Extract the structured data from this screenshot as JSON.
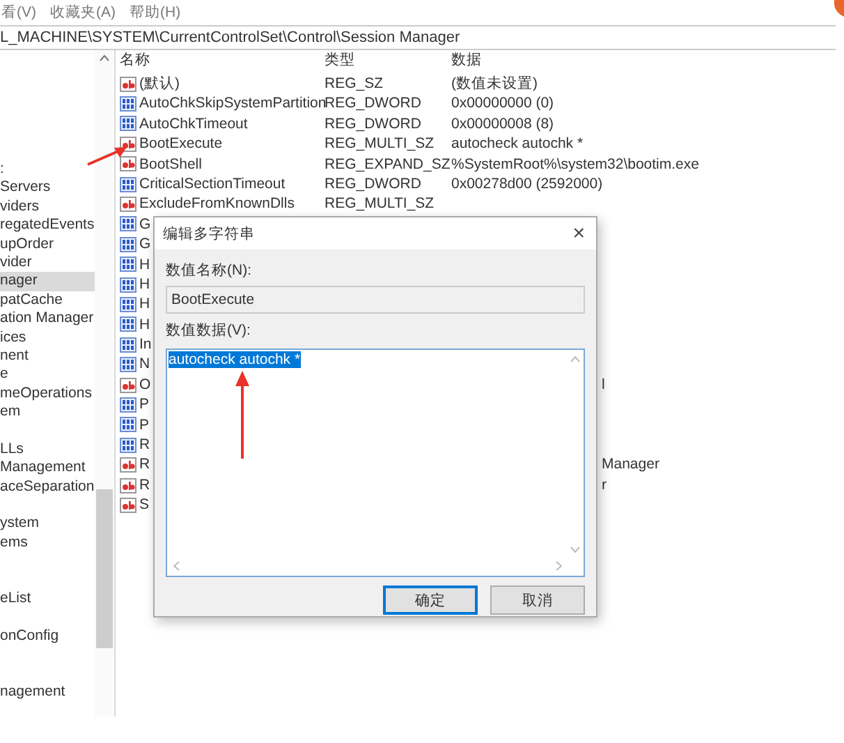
{
  "menu": [
    "看(V)",
    "收藏夹(A)",
    "帮助(H)"
  ],
  "address": "L_MACHINE\\SYSTEM\\CurrentControlSet\\Control\\Session Manager",
  "tree": {
    "items": [
      {
        "kind": "node",
        "label": ":",
        "selected": false
      },
      {
        "kind": "node",
        "label": "Servers",
        "selected": false
      },
      {
        "kind": "node",
        "label": "viders",
        "selected": false
      },
      {
        "kind": "node",
        "label": "regatedEvents",
        "selected": false
      },
      {
        "kind": "node",
        "label": "upOrder",
        "selected": false
      },
      {
        "kind": "node",
        "label": "vider",
        "selected": false
      },
      {
        "kind": "node",
        "label": "nager",
        "selected": true
      },
      {
        "kind": "node",
        "label": "patCache",
        "selected": false
      },
      {
        "kind": "node",
        "label": "ation Manager",
        "selected": false
      },
      {
        "kind": "node",
        "label": "ices",
        "selected": false
      },
      {
        "kind": "node",
        "label": "nent",
        "selected": false
      },
      {
        "kind": "node",
        "label": "e",
        "selected": false
      },
      {
        "kind": "node",
        "label": "meOperations",
        "selected": false
      },
      {
        "kind": "node",
        "label": "em",
        "selected": false
      },
      {
        "kind": "blank"
      },
      {
        "kind": "node",
        "label": "LLs",
        "selected": false
      },
      {
        "kind": "node",
        "label": "Management",
        "selected": false
      },
      {
        "kind": "node",
        "label": "aceSeparation",
        "selected": false
      },
      {
        "kind": "blank"
      },
      {
        "kind": "node",
        "label": "ystem",
        "selected": false
      },
      {
        "kind": "node",
        "label": "ems",
        "selected": false
      },
      {
        "kind": "blank"
      },
      {
        "kind": "blank"
      },
      {
        "kind": "node",
        "label": "eList",
        "selected": false
      },
      {
        "kind": "blank"
      },
      {
        "kind": "node",
        "label": "onConfig",
        "selected": false
      },
      {
        "kind": "blank"
      },
      {
        "kind": "blank"
      },
      {
        "kind": "node",
        "label": "nagement",
        "selected": false
      }
    ]
  },
  "table": {
    "columns": [
      "名称",
      "类型",
      "数据"
    ],
    "rows": [
      {
        "kind": "string",
        "name": "(默认)",
        "type": "REG_SZ",
        "data": "(数值未设置)"
      },
      {
        "kind": "binary",
        "name": "AutoChkSkipSystemPartition",
        "type": "REG_DWORD",
        "data": "0x00000000 (0)"
      },
      {
        "kind": "binary",
        "name": "AutoChkTimeout",
        "type": "REG_DWORD",
        "data": "0x00000008 (8)"
      },
      {
        "kind": "string",
        "name": "BootExecute",
        "type": "REG_MULTI_SZ",
        "data": "autocheck autochk *"
      },
      {
        "kind": "string",
        "name": "BootShell",
        "type": "REG_EXPAND_SZ",
        "data": "%SystemRoot%\\system32\\bootim.exe"
      },
      {
        "kind": "binary",
        "name": "CriticalSectionTimeout",
        "type": "REG_DWORD",
        "data": "0x00278d00 (2592000)"
      },
      {
        "kind": "string",
        "name": "ExcludeFromKnownDlls",
        "type": "REG_MULTI_SZ"
      },
      {
        "kind": "binary",
        "name": "G"
      },
      {
        "kind": "binary",
        "name": "G"
      },
      {
        "kind": "binary",
        "name": "H"
      },
      {
        "kind": "binary",
        "name": "H"
      },
      {
        "kind": "binary",
        "name": "H"
      },
      {
        "kind": "binary",
        "name": "H"
      },
      {
        "kind": "binary",
        "name": "In"
      },
      {
        "kind": "binary",
        "name": "N"
      },
      {
        "kind": "string",
        "name": "O",
        "data_tail": "l"
      },
      {
        "kind": "binary",
        "name": "P"
      },
      {
        "kind": "binary",
        "name": "P"
      },
      {
        "kind": "binary",
        "name": "R"
      },
      {
        "kind": "string",
        "name": "R",
        "data_tail": "Manager"
      },
      {
        "kind": "string",
        "name": "R",
        "data_tail": "r"
      },
      {
        "kind": "string",
        "name": "S"
      }
    ]
  },
  "dialog": {
    "title": "编辑多字符串",
    "close": "×",
    "name_label": "数值名称(N):",
    "name_value": "BootExecute",
    "data_label": "数值数据(V):",
    "data_value": "autocheck autochk *",
    "data_selected": true,
    "buttons": [
      {
        "label": "确定",
        "focused": true
      },
      {
        "label": "取消",
        "focused": false
      }
    ]
  }
}
